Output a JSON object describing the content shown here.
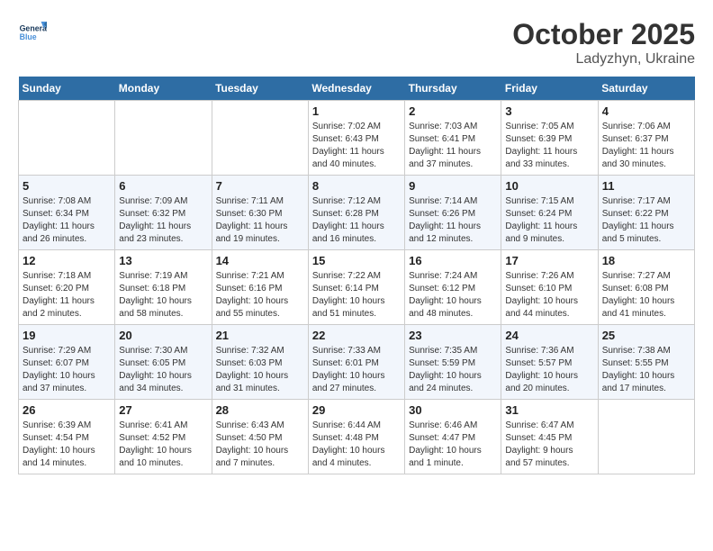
{
  "header": {
    "logo_line1": "General",
    "logo_line2": "Blue",
    "month": "October 2025",
    "location": "Ladyzhyn, Ukraine"
  },
  "weekdays": [
    "Sunday",
    "Monday",
    "Tuesday",
    "Wednesday",
    "Thursday",
    "Friday",
    "Saturday"
  ],
  "weeks": [
    [
      {
        "day": "",
        "info": ""
      },
      {
        "day": "",
        "info": ""
      },
      {
        "day": "",
        "info": ""
      },
      {
        "day": "1",
        "info": "Sunrise: 7:02 AM\nSunset: 6:43 PM\nDaylight: 11 hours\nand 40 minutes."
      },
      {
        "day": "2",
        "info": "Sunrise: 7:03 AM\nSunset: 6:41 PM\nDaylight: 11 hours\nand 37 minutes."
      },
      {
        "day": "3",
        "info": "Sunrise: 7:05 AM\nSunset: 6:39 PM\nDaylight: 11 hours\nand 33 minutes."
      },
      {
        "day": "4",
        "info": "Sunrise: 7:06 AM\nSunset: 6:37 PM\nDaylight: 11 hours\nand 30 minutes."
      }
    ],
    [
      {
        "day": "5",
        "info": "Sunrise: 7:08 AM\nSunset: 6:34 PM\nDaylight: 11 hours\nand 26 minutes."
      },
      {
        "day": "6",
        "info": "Sunrise: 7:09 AM\nSunset: 6:32 PM\nDaylight: 11 hours\nand 23 minutes."
      },
      {
        "day": "7",
        "info": "Sunrise: 7:11 AM\nSunset: 6:30 PM\nDaylight: 11 hours\nand 19 minutes."
      },
      {
        "day": "8",
        "info": "Sunrise: 7:12 AM\nSunset: 6:28 PM\nDaylight: 11 hours\nand 16 minutes."
      },
      {
        "day": "9",
        "info": "Sunrise: 7:14 AM\nSunset: 6:26 PM\nDaylight: 11 hours\nand 12 minutes."
      },
      {
        "day": "10",
        "info": "Sunrise: 7:15 AM\nSunset: 6:24 PM\nDaylight: 11 hours\nand 9 minutes."
      },
      {
        "day": "11",
        "info": "Sunrise: 7:17 AM\nSunset: 6:22 PM\nDaylight: 11 hours\nand 5 minutes."
      }
    ],
    [
      {
        "day": "12",
        "info": "Sunrise: 7:18 AM\nSunset: 6:20 PM\nDaylight: 11 hours\nand 2 minutes."
      },
      {
        "day": "13",
        "info": "Sunrise: 7:19 AM\nSunset: 6:18 PM\nDaylight: 10 hours\nand 58 minutes."
      },
      {
        "day": "14",
        "info": "Sunrise: 7:21 AM\nSunset: 6:16 PM\nDaylight: 10 hours\nand 55 minutes."
      },
      {
        "day": "15",
        "info": "Sunrise: 7:22 AM\nSunset: 6:14 PM\nDaylight: 10 hours\nand 51 minutes."
      },
      {
        "day": "16",
        "info": "Sunrise: 7:24 AM\nSunset: 6:12 PM\nDaylight: 10 hours\nand 48 minutes."
      },
      {
        "day": "17",
        "info": "Sunrise: 7:26 AM\nSunset: 6:10 PM\nDaylight: 10 hours\nand 44 minutes."
      },
      {
        "day": "18",
        "info": "Sunrise: 7:27 AM\nSunset: 6:08 PM\nDaylight: 10 hours\nand 41 minutes."
      }
    ],
    [
      {
        "day": "19",
        "info": "Sunrise: 7:29 AM\nSunset: 6:07 PM\nDaylight: 10 hours\nand 37 minutes."
      },
      {
        "day": "20",
        "info": "Sunrise: 7:30 AM\nSunset: 6:05 PM\nDaylight: 10 hours\nand 34 minutes."
      },
      {
        "day": "21",
        "info": "Sunrise: 7:32 AM\nSunset: 6:03 PM\nDaylight: 10 hours\nand 31 minutes."
      },
      {
        "day": "22",
        "info": "Sunrise: 7:33 AM\nSunset: 6:01 PM\nDaylight: 10 hours\nand 27 minutes."
      },
      {
        "day": "23",
        "info": "Sunrise: 7:35 AM\nSunset: 5:59 PM\nDaylight: 10 hours\nand 24 minutes."
      },
      {
        "day": "24",
        "info": "Sunrise: 7:36 AM\nSunset: 5:57 PM\nDaylight: 10 hours\nand 20 minutes."
      },
      {
        "day": "25",
        "info": "Sunrise: 7:38 AM\nSunset: 5:55 PM\nDaylight: 10 hours\nand 17 minutes."
      }
    ],
    [
      {
        "day": "26",
        "info": "Sunrise: 6:39 AM\nSunset: 4:54 PM\nDaylight: 10 hours\nand 14 minutes."
      },
      {
        "day": "27",
        "info": "Sunrise: 6:41 AM\nSunset: 4:52 PM\nDaylight: 10 hours\nand 10 minutes."
      },
      {
        "day": "28",
        "info": "Sunrise: 6:43 AM\nSunset: 4:50 PM\nDaylight: 10 hours\nand 7 minutes."
      },
      {
        "day": "29",
        "info": "Sunrise: 6:44 AM\nSunset: 4:48 PM\nDaylight: 10 hours\nand 4 minutes."
      },
      {
        "day": "30",
        "info": "Sunrise: 6:46 AM\nSunset: 4:47 PM\nDaylight: 10 hours\nand 1 minute."
      },
      {
        "day": "31",
        "info": "Sunrise: 6:47 AM\nSunset: 4:45 PM\nDaylight: 9 hours\nand 57 minutes."
      },
      {
        "day": "",
        "info": ""
      }
    ]
  ]
}
